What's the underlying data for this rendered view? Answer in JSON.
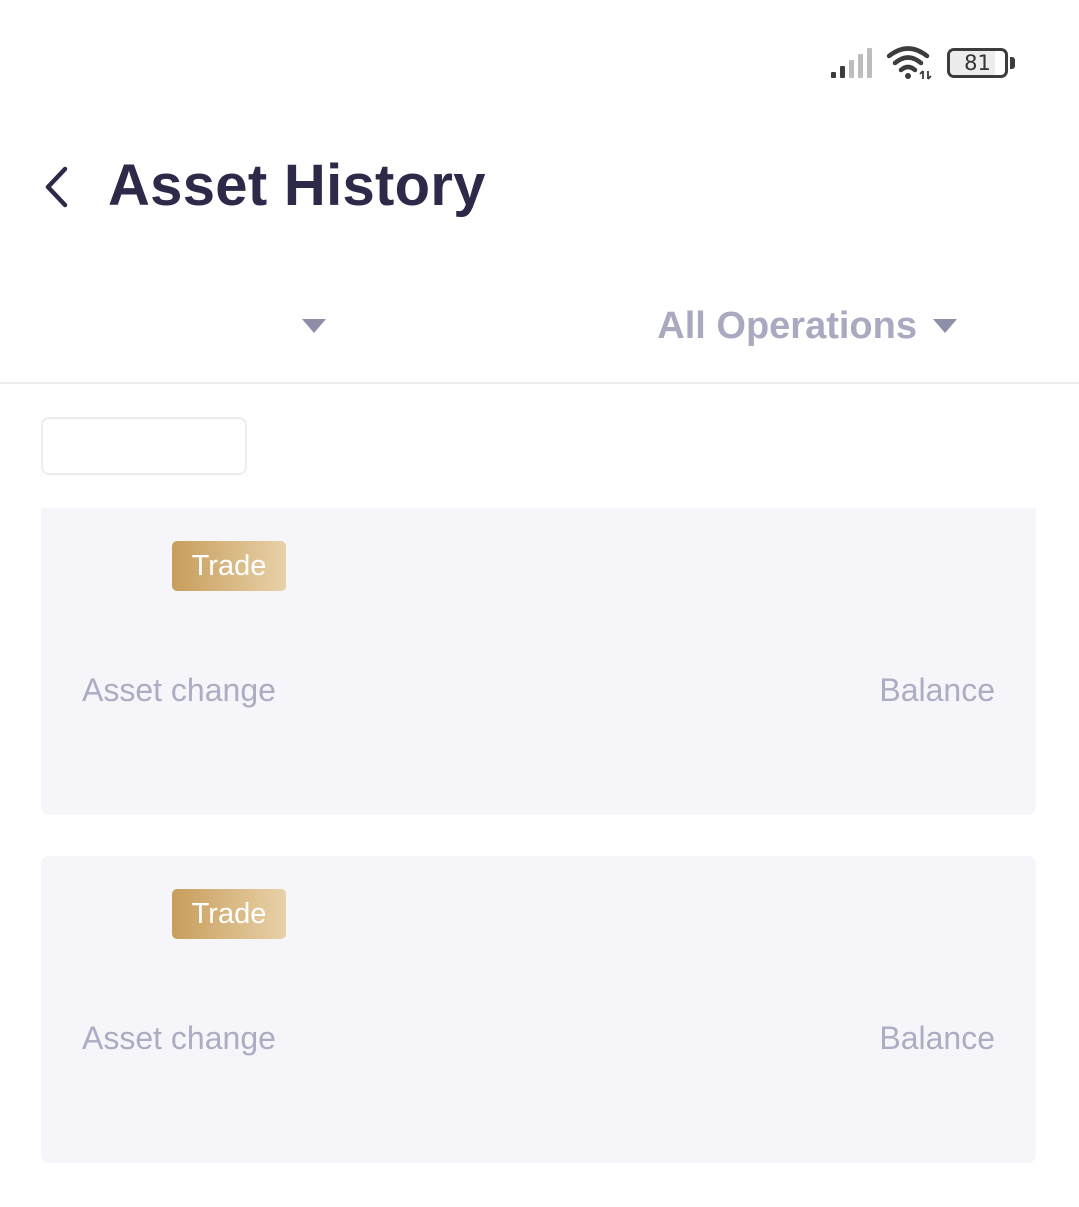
{
  "status_bar": {
    "battery_level": "81",
    "battery_fraction": 0.81,
    "signal_icon": "signal-bars-icon",
    "wifi_icon": "wifi-icon"
  },
  "header": {
    "back_icon": "chevron-left-icon",
    "title": "Asset History"
  },
  "filters": {
    "coin_selector_label": "",
    "operations_label": "All Operations",
    "dropdown_icon": "caret-down-icon"
  },
  "date_filter": {
    "label": ""
  },
  "records": [
    {
      "type_badge": "Trade",
      "asset_change_label": "Asset change",
      "balance_label": "Balance"
    },
    {
      "type_badge": "Trade",
      "asset_change_label": "Asset change",
      "balance_label": "Balance"
    }
  ],
  "colors": {
    "title": "#2c2a48",
    "muted_text": "#acacc2",
    "card_background": "#f6f6fa",
    "badge_gradient_start": "#c79e5c",
    "badge_gradient_end": "#e8d1a8",
    "divider": "#ececf0"
  }
}
